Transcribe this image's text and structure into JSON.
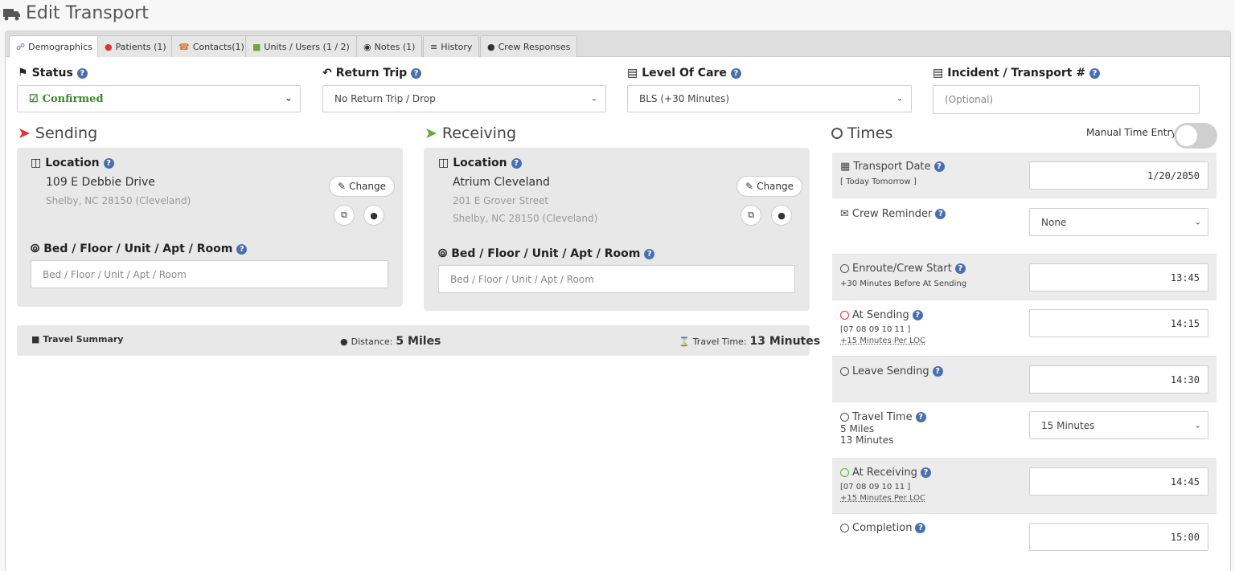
{
  "page": {
    "title": "Edit Transport"
  },
  "tabs": [
    {
      "label": "Demographics",
      "icon": "sitemap-icon",
      "color": "#4a6fb0"
    },
    {
      "label": "Patients (1)",
      "icon": "user-icon",
      "color": "#d33"
    },
    {
      "label": "Contacts(1)",
      "icon": "phone-icon",
      "color": "#e07020"
    },
    {
      "label": "Units / Users (1 / 2)",
      "icon": "truck-icon",
      "color": "#6a3"
    },
    {
      "label": "Notes (1)",
      "icon": "comment-icon",
      "color": "#333"
    },
    {
      "label": "History",
      "icon": "list-icon",
      "color": "#333"
    },
    {
      "label": "Crew Responses",
      "icon": "users-icon",
      "color": "#333"
    }
  ],
  "fields": {
    "status": {
      "label": "Status",
      "value": "Confirmed",
      "color": "#3a8a2a"
    },
    "return_trip": {
      "label": "Return Trip",
      "value": "No Return Trip / Drop"
    },
    "level_of_care": {
      "label": "Level Of Care",
      "value": "BLS (+30 Minutes)"
    },
    "incident": {
      "label": "Incident / Transport #",
      "placeholder": "(Optional)"
    }
  },
  "sending": {
    "title": "Sending",
    "location_label": "Location",
    "address_line1": "109 E Debbie Drive",
    "address_line2": "Shelby, NC 28150 (Cleveland)",
    "change_label": "Change",
    "bed_label": "Bed / Floor / Unit / Apt / Room",
    "bed_placeholder": "Bed / Floor / Unit / Apt / Room",
    "accent": "#d33"
  },
  "receiving": {
    "title": "Receiving",
    "location_label": "Location",
    "name": "Atrium Cleveland",
    "address_line1": "201 E Grover Street",
    "address_line2": "Shelby, NC 28150 (Cleveland)",
    "change_label": "Change",
    "bed_label": "Bed / Floor / Unit / Apt / Room",
    "bed_placeholder": "Bed / Floor / Unit / Apt / Room",
    "accent": "#6a3"
  },
  "travel_summary": {
    "label": "Travel Summary",
    "distance_label": "Distance:",
    "distance_value": "5 Miles",
    "time_label": "Travel Time:",
    "time_value": "13 Minutes"
  },
  "times": {
    "title": "Times",
    "manual_label": "Manual Time Entry",
    "manual_enabled": false,
    "transport_date": {
      "label": "Transport Date",
      "sub": "[ Today  Tomorrow ]",
      "value": "1/20/2050"
    },
    "crew_reminder": {
      "label": "Crew Reminder",
      "value": "None"
    },
    "enroute": {
      "label": "Enroute/Crew Start",
      "sub": "+30 Minutes Before At Sending",
      "value": "13:45"
    },
    "at_sending": {
      "label": "At Sending",
      "sub1": "[07 08 09 10 11 ]",
      "sub2": "+15 Minutes Per LOC",
      "value": "14:15"
    },
    "leave_sending": {
      "label": "Leave Sending",
      "value": "14:30"
    },
    "travel_time": {
      "label": "Travel Time",
      "sub1": "5 Miles",
      "sub2": "13 Minutes",
      "value": "15 Minutes"
    },
    "at_receiving": {
      "label": "At Receiving",
      "sub1": "[07 08 09 10 11 ]",
      "sub2": "+15 Minutes Per LOC",
      "value": "14:45"
    },
    "completion": {
      "label": "Completion",
      "value": "15:00"
    }
  }
}
